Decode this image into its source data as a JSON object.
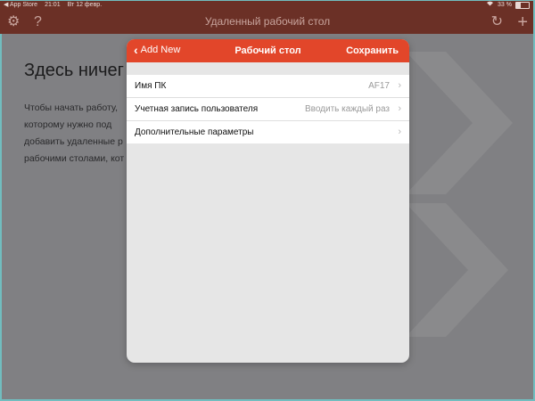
{
  "status_bar": {
    "back_app": "◀ App Store",
    "time": "21:01",
    "date": "Вт 12 февр.",
    "battery_percent": "33 %",
    "battery_level": 0.33
  },
  "navbar": {
    "title": "Удаленный рабочий стол",
    "settings_icon": "gear-icon",
    "help_icon": "question-icon",
    "refresh_icon": "refresh-icon",
    "add_icon": "plus-icon"
  },
  "background": {
    "heading": "Здесь ничег",
    "lines": [
      "Чтобы  начать  работу,",
      "которому  нужно  под",
      "добавить  удаленные  р",
      "рабочими столами, кот"
    ]
  },
  "modal": {
    "back_label": "Add New",
    "title": "Рабочий стол",
    "save_label": "Сохранить",
    "rows": [
      {
        "label": "Имя ПК",
        "value": "AF17"
      },
      {
        "label": "Учетная запись пользователя",
        "value": "Вводить каждый раз"
      },
      {
        "label": "Дополнительные параметры",
        "value": ""
      }
    ]
  },
  "colors": {
    "accent": "#e2462a",
    "navbar_dim": "#6b3026",
    "overlay": "#808083"
  }
}
